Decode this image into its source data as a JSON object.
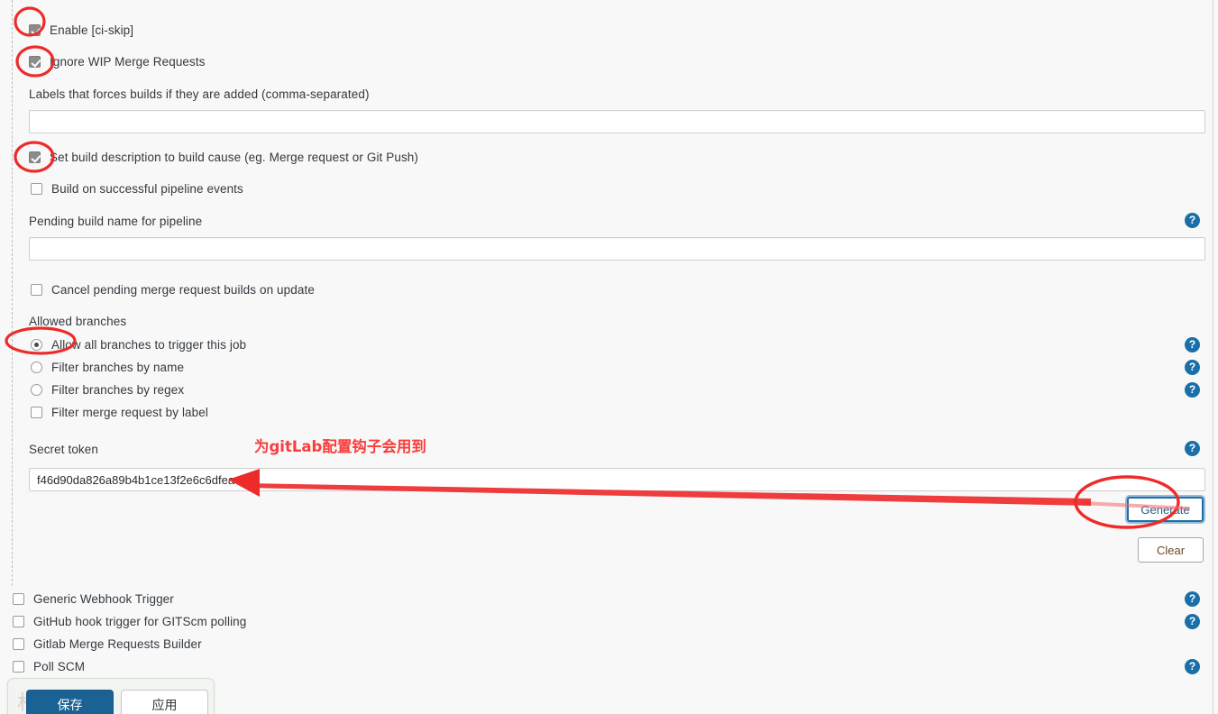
{
  "colors": {
    "page_bg": "#f8f8f8",
    "annotation_red": "#ee2b2b",
    "help_blue": "#1a6fa8",
    "save_blue": "#1a6294",
    "focus_blue": "#1b6ea8"
  },
  "options": {
    "enable_ci_skip": {
      "label": "Enable [ci-skip]",
      "checked": true
    },
    "ignore_wip": {
      "label": "Ignore WIP Merge Requests",
      "checked": true
    },
    "set_build_description": {
      "label": "Set build description to build cause (eg. Merge request or Git Push)",
      "checked": true
    },
    "build_on_pipeline": {
      "label": "Build on successful pipeline events",
      "checked": false
    },
    "cancel_pending": {
      "label": "Cancel pending merge request builds on update",
      "checked": false
    },
    "filter_mr_by_label": {
      "label": "Filter merge request by label",
      "checked": false
    }
  },
  "fields": {
    "labels_forces_builds": {
      "label": "Labels that forces builds if they are added (comma-separated)",
      "value": "",
      "placeholder": ""
    },
    "pending_build_name": {
      "label": "Pending build name for pipeline",
      "value": "",
      "placeholder": ""
    },
    "secret_token": {
      "label": "Secret token",
      "value": "f46d90da826a89b4b1ce13f2e6c6dfea",
      "placeholder": ""
    }
  },
  "allowed_branches": {
    "label": "Allowed branches",
    "selected": "allow_all",
    "radios": [
      {
        "id": "allow_all",
        "label": "Allow all branches to trigger this job",
        "selected": true
      },
      {
        "id": "filter_name",
        "label": "Filter branches by name",
        "selected": false
      },
      {
        "id": "filter_regex",
        "label": "Filter branches by regex",
        "selected": false
      }
    ]
  },
  "token_buttons": {
    "generate": "Generate",
    "clear": "Clear"
  },
  "trigger_list": [
    {
      "label": "Generic Webhook Trigger",
      "checked": false
    },
    {
      "label": "GitHub hook trigger for GITScm polling",
      "checked": false
    },
    {
      "label": "Gitlab Merge Requests Builder",
      "checked": false
    },
    {
      "label": "Poll SCM",
      "checked": false
    }
  ],
  "help_icons": {
    "glyph": "?",
    "name": "help-icon",
    "count": 7
  },
  "save_bar": {
    "save_label": "保存",
    "apply_label": "应用",
    "watermark": "材"
  },
  "annotations": {
    "chinese_note": "为gitLab配置钩子会用到",
    "circles": [
      "circle-enable-ci-skip",
      "circle-ignore-wip",
      "circle-set-build-description",
      "circle-allow-all-branches",
      "circle-generate-button"
    ],
    "arrow": "arrow-to-secret-token"
  }
}
